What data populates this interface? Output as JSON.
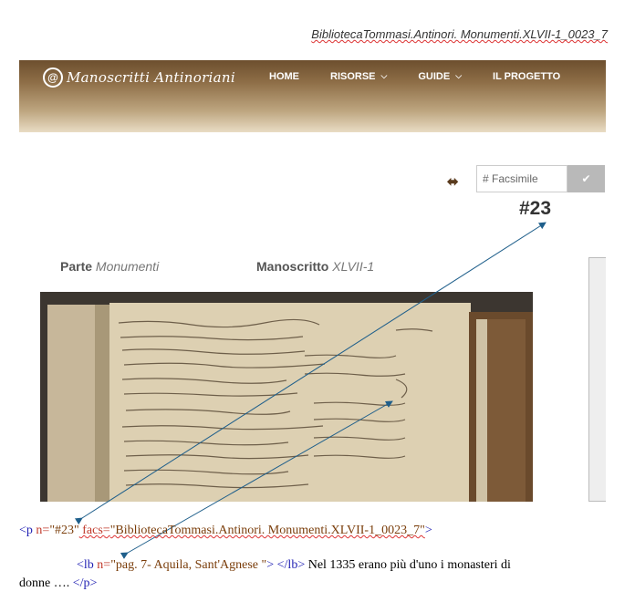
{
  "caption": {
    "text": "BibliotecaTommasi.Antinori. Monumenti.XLVII-1_0023_7"
  },
  "navbar": {
    "logo_text": "Manoscritti Antinoriani",
    "logo_symbol": "@",
    "menu": [
      {
        "label": "HOME"
      },
      {
        "label": "RISORSE"
      },
      {
        "label": "GUIDE"
      },
      {
        "label": "IL PROGETTO"
      }
    ],
    "colors": {
      "top": "#6d4f2e",
      "bottom": "#e9dcc4"
    }
  },
  "toolbar": {
    "facsimile_placeholder": "# Facsimile",
    "swap_icon": "arrows-left-right-icon",
    "go_icon": "check-icon"
  },
  "page_number": "#23",
  "meta": {
    "parte_label": "Parte",
    "parte_value": "Monumenti",
    "manoscritto_label": "Manoscritto",
    "manoscritto_value": "XLVII-1"
  },
  "code": {
    "line1": {
      "open": "<p",
      "attr1": " n=",
      "val1": "\"#23\"",
      "attr2": " facs=",
      "val2": "\"BibliotecaTommasi.Antinori. Monumenti.XLVII-1_0023_7\"",
      "close": ">"
    },
    "line2": {
      "open": "<lb",
      "attr1": " n=",
      "val1": "\"pag. 7- Aquila, Sant'Agnese \"",
      "close": "> </lb>",
      "text": " Nel 1335 erano più d'uno i monasteri di"
    },
    "line3": {
      "text": "donne …. ",
      "close": "</p>"
    }
  }
}
